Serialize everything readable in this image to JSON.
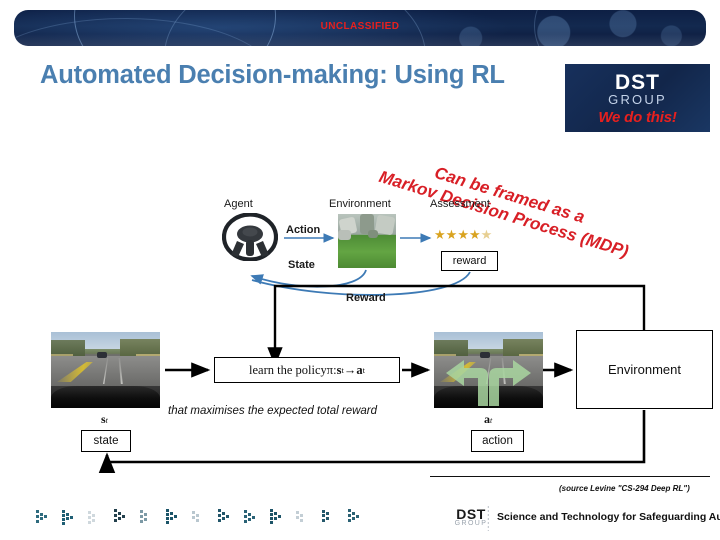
{
  "banner": {
    "classification": "UNCLASSIFIED"
  },
  "title": "Automated Decision-making: Using RL",
  "logo": {
    "name": "DST",
    "sub": "GROUP",
    "tagline": "We do this!"
  },
  "annotation": {
    "line1": "Can be framed as a",
    "line2": "Markov Decision Process (MDP)"
  },
  "loop_diagram": {
    "agent_label": "Agent",
    "environment_label": "Environment",
    "assessment_label": "Assessment",
    "action_label": "Action",
    "state_label": "State",
    "reward_label": "Reward",
    "reward_box": "reward",
    "stars_filled": 4,
    "stars_total": 5
  },
  "flow_diagram": {
    "state_image_caption": "s",
    "state_image_sub": "t",
    "policy_text_prefix": "learn the policy ",
    "policy_symbol": "π",
    "policy_colon": " : ",
    "policy_state": "s",
    "policy_arrow": " → ",
    "policy_action": "a",
    "policy_sub": "t",
    "maximises_text": "that maximises the expected total reward",
    "action_image_caption": "a",
    "action_image_sub": "t",
    "environment_box": "Environment",
    "state_box": "state",
    "action_box": "action"
  },
  "source_note": "(source Levine \"CS-294 Deep RL\")",
  "footer": {
    "dst": "DST",
    "dst_sub": "GROUP",
    "tagline": "Science and Technology for Safeguarding Australia",
    "chevron_count": 13
  },
  "colors": {
    "title_blue": "#4a7fb0",
    "classified_red": "#e8201e",
    "annotation_red": "#d81f26",
    "banner_navy": "#0d1f44",
    "star_gold": "#d9a320",
    "connector_blue": "#3d7ab5",
    "action_arrow_green": "#a9d6a0"
  }
}
